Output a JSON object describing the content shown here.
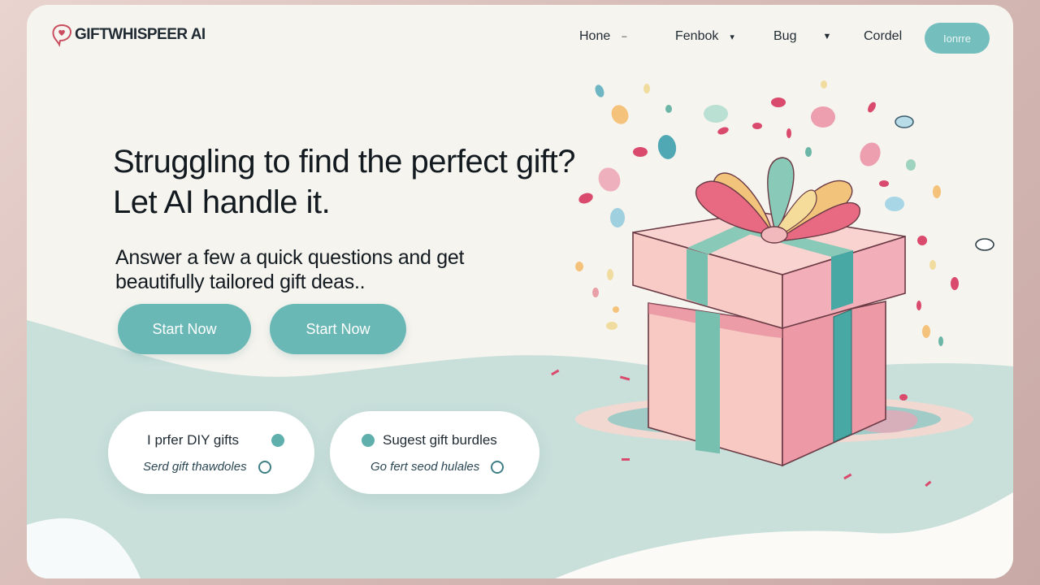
{
  "brand": {
    "name": "GIFTWHISPEER AI",
    "logo_icon": "chat-heart-icon"
  },
  "nav": {
    "items": [
      {
        "label": "Hone",
        "has_dropdown": true
      },
      {
        "label": "Fenbok",
        "has_dropdown": true
      },
      {
        "label": "Bug",
        "has_dropdown": true
      },
      {
        "label": "Cordel",
        "has_dropdown": false
      }
    ],
    "cta_label": "Ionrre"
  },
  "hero": {
    "headline": "Struggling to find the perfect gift? Let AI handle it.",
    "subhead": "Answer a few a quick questions and get beautifully tailored gift deas..",
    "buttons": [
      {
        "label": "Start Now"
      },
      {
        "label": "Start Now"
      }
    ]
  },
  "options": [
    {
      "label": "I prfer DIY gifts",
      "selected": true,
      "sub_label": "Serd gift thawdoles",
      "sub_selected": false
    },
    {
      "label": "Sugest gift burdles",
      "selected": true,
      "sub_label": "Go fert seod hulales",
      "sub_selected": false
    }
  ],
  "illustration": {
    "name": "gift-box-illustration",
    "confetti": "confetti"
  },
  "colors": {
    "accent": "#6ab8b6",
    "background": "#f6f4ef",
    "wave": "#c8dfda",
    "text": "#121a20",
    "box_pink": "#f2b9bd",
    "ribbon_teal": "#6bb6a6"
  }
}
